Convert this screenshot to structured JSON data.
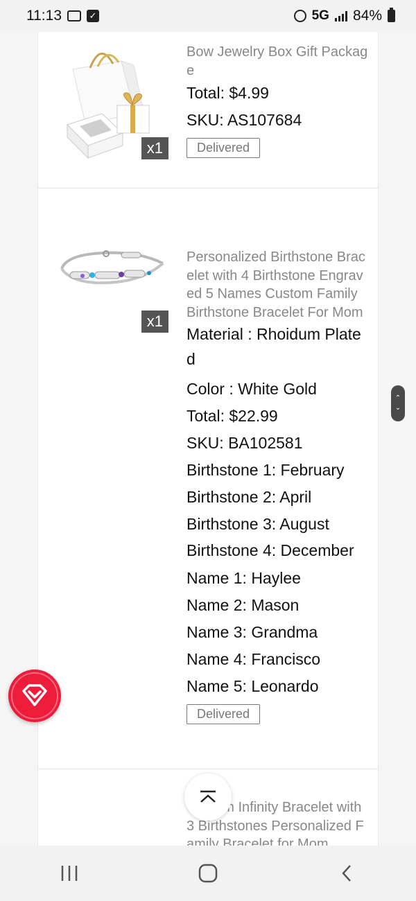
{
  "status_bar": {
    "time": "11:13",
    "network": "5G",
    "battery": "84%"
  },
  "orders": [
    {
      "title": "Bow Jewelry Box Gift Package",
      "quantity": "x1",
      "total_label": "Total:",
      "total_value": "$4.99",
      "sku_label": "SKU:",
      "sku_value": "AS107684",
      "status": "Delivered"
    },
    {
      "title": "Personalized Birthstone Bracelet with 4 Birthstone Engraved 5 Names Custom Family Birthstone Bracelet For Mom",
      "quantity": "x1",
      "material": "Material : Rhoidum Plated",
      "color": "Color : White Gold",
      "total_label": "Total:",
      "total_value": "$22.99",
      "sku_label": "SKU:",
      "sku_value": "BA102581",
      "birthstones": [
        "Birthstone 1: February",
        "Birthstone 2: April",
        "Birthstone 3: August",
        "Birthstone 4: December"
      ],
      "names": [
        "Name 1: Haylee",
        "Name 2: Mason",
        "Name 3: Grandma",
        "Name 4: Francisco",
        "Name 5: Leonardo"
      ],
      "status": "Delivered"
    },
    {
      "title": "Custom Infinity Bracelet with 3 Birthstones Personalized Family Bracelet for Mom"
    }
  ],
  "icons": {
    "scroll_handle": "scroll-handle-icon",
    "floating_action": "diamond-icon",
    "back_to_top": "back-to-top-icon",
    "nav_recent": "recent-apps-icon",
    "nav_home": "home-icon",
    "nav_back": "back-icon"
  },
  "colors": {
    "fab": "#ee1c3b",
    "qty_badge": "#555555",
    "title_text": "#888888"
  }
}
